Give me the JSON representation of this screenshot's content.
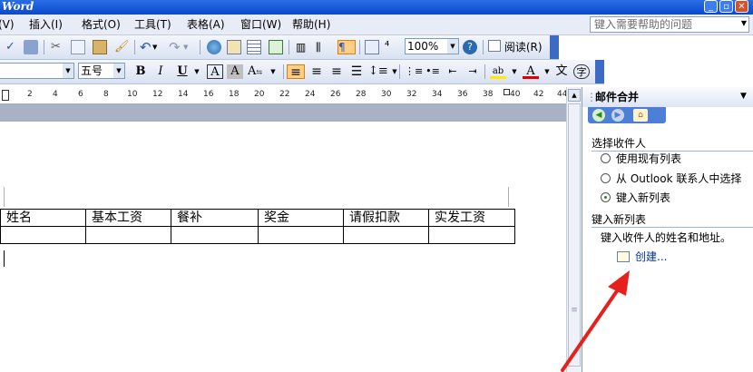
{
  "app": {
    "title": "Word"
  },
  "menubar": {
    "items": [
      "视图(V)",
      "插入(I)",
      "格式(O)",
      "工具(T)",
      "表格(A)",
      "窗口(W)",
      "帮助(H)"
    ],
    "help_placeholder": "键入需要帮助的问题"
  },
  "toolbar": {
    "zoom": "100%",
    "read_label": "阅读(R)"
  },
  "formatting": {
    "font_size": "五号"
  },
  "ruler": {
    "ticks": [
      "2",
      "4",
      "6",
      "8",
      "10",
      "12",
      "14",
      "16",
      "18",
      "20",
      "22",
      "24",
      "26",
      "28",
      "30",
      "32",
      "34",
      "36",
      "38",
      "40",
      "42",
      "44"
    ]
  },
  "document": {
    "table_headers": [
      "姓名",
      "基本工资",
      "餐补",
      "奖金",
      "请假扣款",
      "实发工资"
    ]
  },
  "task_pane": {
    "title": "邮件合并",
    "select_recipients_heading": "选择收件人",
    "options": [
      "使用现有列表",
      "从 Outlook 联系人中选择",
      "键入新列表"
    ],
    "selected_option": 2,
    "new_list_heading": "键入新列表",
    "new_list_desc": "键入收件人的姓名和地址。",
    "create_link": "创建..."
  },
  "colors": {
    "accent_arrow": "#e8201c",
    "title_bar": "#0a48c8"
  },
  "icons": [
    "save-icon",
    "print-icon",
    "cut-icon",
    "copy-icon",
    "paste-icon",
    "format-painter-icon",
    "undo-icon",
    "redo-icon",
    "hyperlink-icon",
    "table-icon",
    "columns-icon",
    "drawing-icon",
    "help-icon",
    "bold-icon",
    "italic-icon",
    "underline-icon",
    "align-left-icon",
    "align-center-icon",
    "align-right-icon",
    "justify-icon",
    "numbering-icon",
    "bullets-icon",
    "highlight-icon",
    "font-color-icon",
    "back-icon",
    "forward-icon",
    "home-icon",
    "new-list-icon",
    "close-icon"
  ]
}
